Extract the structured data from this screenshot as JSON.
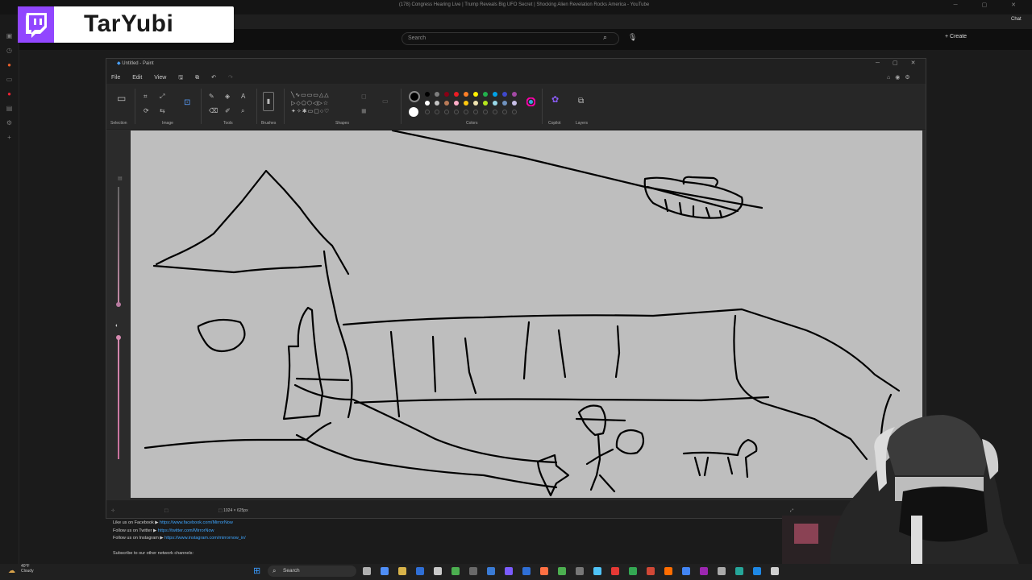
{
  "browser": {
    "tab_title": "(178) Congress Hearing Live | Trump Reveals Big UFO Secret | Shocking Alien Revelation Rocks America - YouTube",
    "chat_label": "Chat"
  },
  "youtube": {
    "search_placeholder": "Search",
    "create_label": "Create"
  },
  "overlay": {
    "streamer_name": "TarYubi",
    "platform_icon": "twitch-icon"
  },
  "paint": {
    "window_title": "Untitled - Paint",
    "menus": [
      "File",
      "Edit",
      "View"
    ],
    "ribbon_groups": [
      "Selection",
      "Image",
      "Tools",
      "Brushes",
      "Shapes",
      "Colors",
      "Copilot",
      "Layers"
    ],
    "canvas_size": "1024 × 625px",
    "colors": [
      "#000000",
      "#7f7f7f",
      "#880015",
      "#ed1c24",
      "#ff7f27",
      "#fff200",
      "#22b14c",
      "#00a2e8",
      "#3f48cc",
      "#a349a4",
      "#ffffff",
      "#c3c3c3",
      "#b97a57",
      "#ffaec9",
      "#ffc90e",
      "#efe4b0",
      "#b5e61d",
      "#99d9ea",
      "#7092be",
      "#c8bfe7"
    ]
  },
  "description": {
    "lines": [
      {
        "prefix": "Like us on Facebook ▶ ",
        "link": "https://www.facebook.com/MirrorNow"
      },
      {
        "prefix": "Follow us on Twitter ▶ ",
        "link": "https://twitter.com/MirrorNow"
      },
      {
        "prefix": "Follow us on Instagram ▶ ",
        "link": "https://www.instagram.com/mirrornow_in/"
      }
    ],
    "subscribe_line": "Subscribe to our other network channels:"
  },
  "taskbar": {
    "temperature": "40°F",
    "weather": "Cloudy",
    "search_label": "Search"
  }
}
